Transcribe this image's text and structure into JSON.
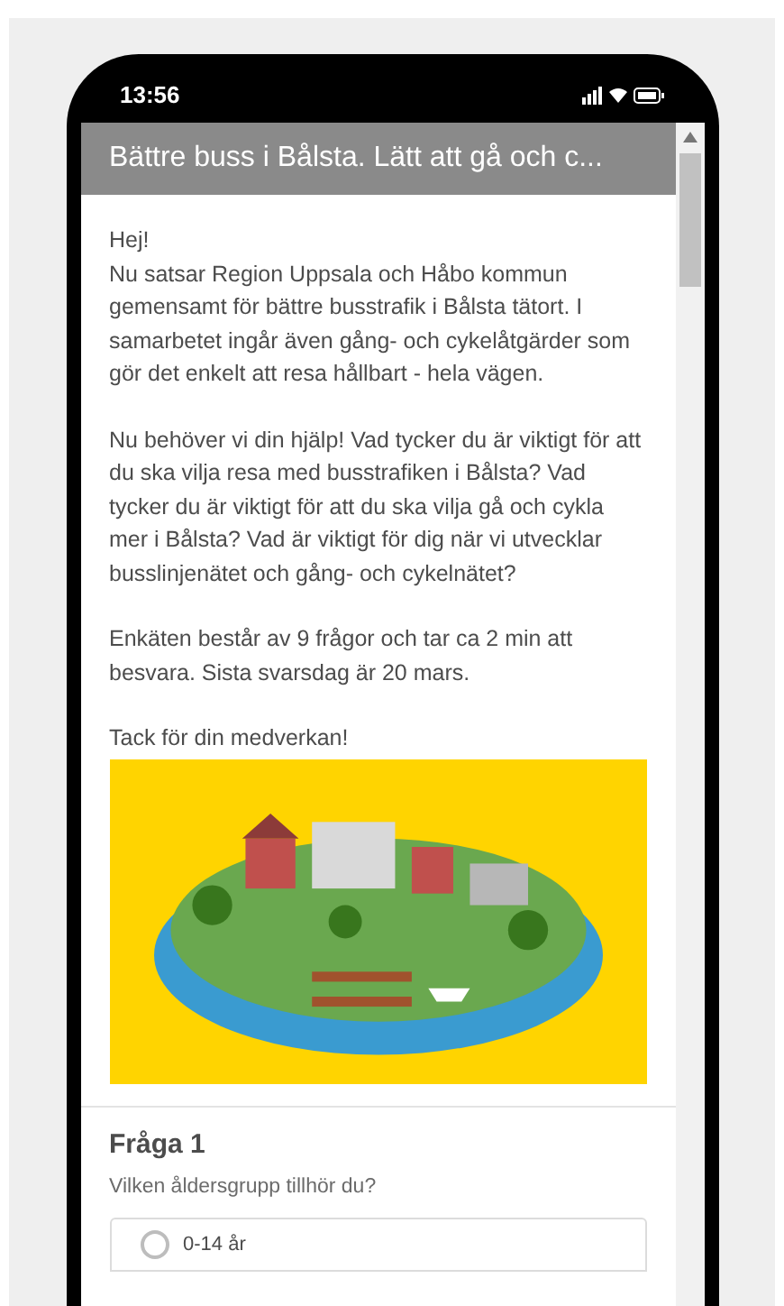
{
  "status_bar": {
    "time": "13:56"
  },
  "header": {
    "title": "Bättre buss i Bålsta. Lätt att gå och c..."
  },
  "intro": {
    "paragraphs": [
      "Hej!\nNu satsar Region Uppsala och Håbo kommun gemensamt för bättre busstrafik i Bålsta tätort. I samarbetet ingår även gång- och cykelåtgärder som gör det enkelt att resa hållbart - hela vägen.",
      "Nu behöver vi din hjälp! Vad tycker du är viktigt för att du ska vilja resa med busstrafiken i Bålsta? Vad tycker du är viktigt för att du ska vilja gå och cykla mer i Bålsta?  Vad är viktigt för dig när vi utvecklar busslinjenätet och gång- och cykelnätet?",
      "Enkäten består av 9 frågor och tar ca 2 min att besvara. Sista svarsdag är 20 mars.",
      "Tack för din medverkan!"
    ]
  },
  "question": {
    "title": "Fråga 1",
    "text": "Vilken åldersgrupp tillhör du?",
    "options": [
      {
        "label": "0-14 år",
        "selected": false
      }
    ]
  }
}
